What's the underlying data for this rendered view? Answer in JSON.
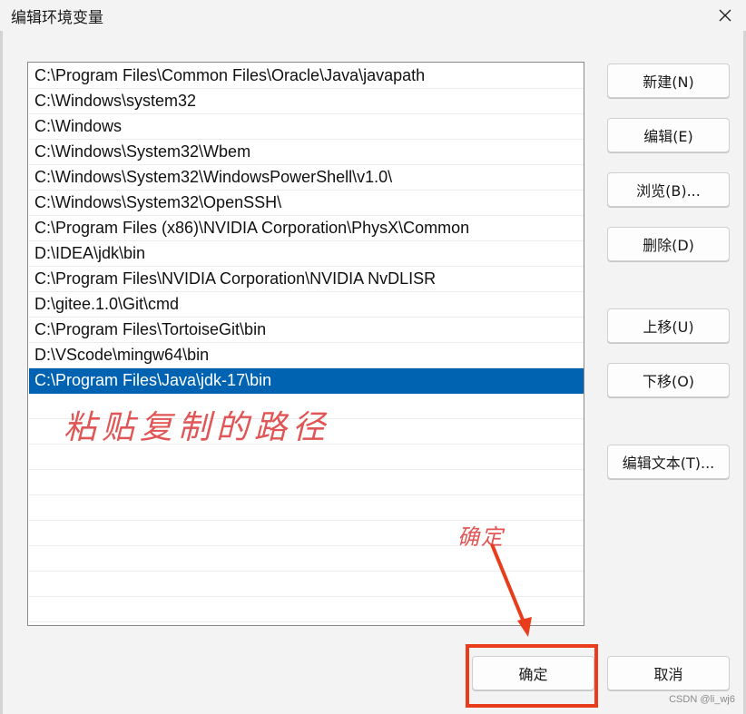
{
  "window": {
    "title": "编辑环境变量",
    "close_symbol": "✕"
  },
  "path_list": [
    "C:\\Program Files\\Common Files\\Oracle\\Java\\javapath",
    "C:\\Windows\\system32",
    "C:\\Windows",
    "C:\\Windows\\System32\\Wbem",
    "C:\\Windows\\System32\\WindowsPowerShell\\v1.0\\",
    "C:\\Windows\\System32\\OpenSSH\\",
    "C:\\Program Files (x86)\\NVIDIA Corporation\\PhysX\\Common",
    "D:\\IDEA\\jdk\\bin",
    "C:\\Program Files\\NVIDIA Corporation\\NVIDIA NvDLISR",
    "D:\\gitee.1.0\\Git\\cmd",
    "C:\\Program Files\\TortoiseGit\\bin",
    "D:\\VScode\\mingw64\\bin",
    "C:\\Program Files\\Java\\jdk-17\\bin"
  ],
  "selected_index": 12,
  "buttons": {
    "new": "新建(N)",
    "edit": "编辑(E)",
    "browse": "浏览(B)...",
    "delete": "删除(D)",
    "move_up": "上移(U)",
    "move_down": "下移(O)",
    "edit_text": "编辑文本(T)...",
    "ok": "确定",
    "cancel": "取消"
  },
  "annotations": {
    "paste_note": "粘贴复制的路径",
    "ok_note": "确定"
  },
  "watermark": "CSDN @li_wj6",
  "colors": {
    "selection": "#0063b1",
    "annotation": "#e05555",
    "highlight": "#e83c1c"
  }
}
